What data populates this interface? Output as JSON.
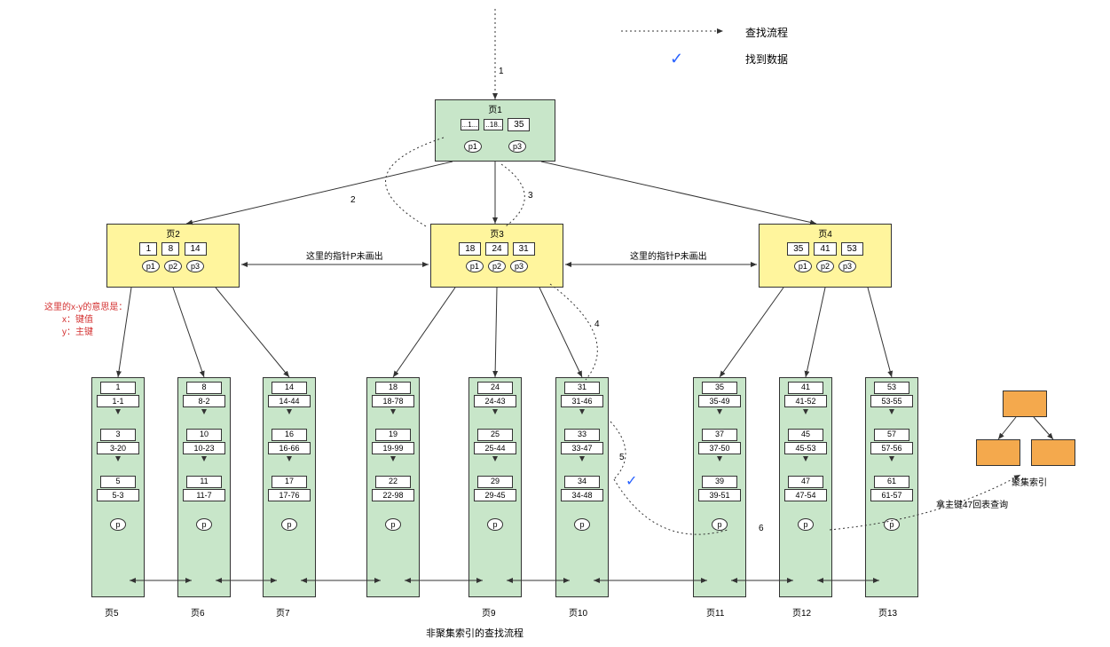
{
  "legend": {
    "flow": "查找流程",
    "found": "找到数据"
  },
  "root": {
    "title": "页1",
    "keys": [
      "...1...",
      "..18..",
      "35"
    ],
    "ptrs": [
      "p1",
      "",
      "p3"
    ]
  },
  "mids": [
    {
      "title": "页2",
      "keys": [
        "1",
        "8",
        "14"
      ],
      "ptrs": [
        "p1",
        "p2",
        "p3"
      ]
    },
    {
      "title": "页3",
      "keys": [
        "18",
        "24",
        "31"
      ],
      "ptrs": [
        "p1",
        "p2",
        "p3"
      ]
    },
    {
      "title": "页4",
      "keys": [
        "35",
        "41",
        "53"
      ],
      "ptrs": [
        "p1",
        "p2",
        "p3"
      ]
    }
  ],
  "mid_note_left": "这里的指针P未画出",
  "mid_note_right": "这里的指针P未画出",
  "red_note": {
    "l1": "这里的x-y的意思是：",
    "l2": "x：键值",
    "l3": "y：主键"
  },
  "leaves": [
    {
      "title": "页5",
      "rows": [
        {
          "k": "1",
          "v": "1-1"
        },
        {
          "k": "3",
          "v": "3-20"
        },
        {
          "k": "5",
          "v": "5-3"
        }
      ]
    },
    {
      "title": "页6",
      "rows": [
        {
          "k": "8",
          "v": "8-2"
        },
        {
          "k": "10",
          "v": "10-23"
        },
        {
          "k": "11",
          "v": "11-7"
        }
      ]
    },
    {
      "title": "页7",
      "rows": [
        {
          "k": "14",
          "v": "14-44"
        },
        {
          "k": "16",
          "v": "16-66"
        },
        {
          "k": "17",
          "v": "17-76"
        }
      ]
    },
    {
      "title": "",
      "rows": [
        {
          "k": "18",
          "v": "18-78"
        },
        {
          "k": "19",
          "v": "19-99"
        },
        {
          "k": "22",
          "v": "22-98"
        }
      ]
    },
    {
      "title": "页9",
      "rows": [
        {
          "k": "24",
          "v": "24-43"
        },
        {
          "k": "25",
          "v": "25-44"
        },
        {
          "k": "29",
          "v": "29-45"
        }
      ]
    },
    {
      "title": "页10",
      "rows": [
        {
          "k": "31",
          "v": "31-46"
        },
        {
          "k": "33",
          "v": "33-47"
        },
        {
          "k": "34",
          "v": "34-48"
        }
      ]
    },
    {
      "title": "页11",
      "rows": [
        {
          "k": "35",
          "v": "35-49"
        },
        {
          "k": "37",
          "v": "37-50"
        },
        {
          "k": "39",
          "v": "39-51"
        }
      ]
    },
    {
      "title": "页12",
      "rows": [
        {
          "k": "41",
          "v": "41-52"
        },
        {
          "k": "45",
          "v": "45-53"
        },
        {
          "k": "47",
          "v": "47-54"
        }
      ]
    },
    {
      "title": "页13",
      "rows": [
        {
          "k": "53",
          "v": "53-55"
        },
        {
          "k": "57",
          "v": "57-56"
        },
        {
          "k": "61",
          "v": "61-57"
        }
      ]
    }
  ],
  "p_label": "p",
  "caption": "非聚集索引的查找流程",
  "cluster_label": "聚集索引",
  "back_query": "拿主键47回表查询",
  "steps": {
    "s1": "1",
    "s2": "2",
    "s3": "3",
    "s4": "4",
    "s5": "5",
    "s6": "6"
  },
  "check": "✓"
}
